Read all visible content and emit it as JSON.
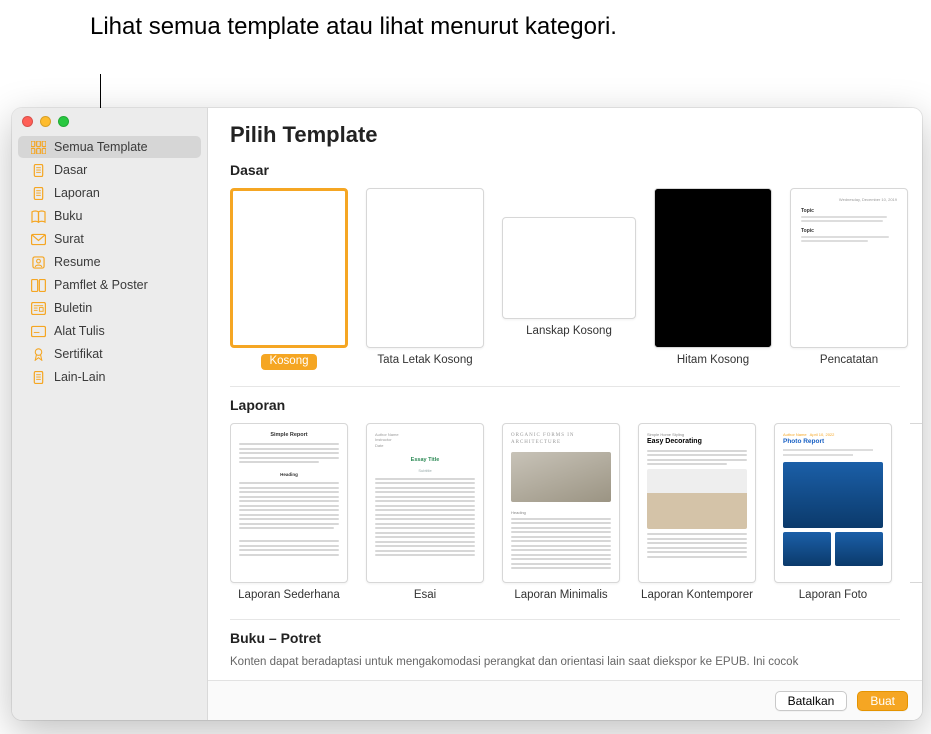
{
  "annotation": "Lihat semua template atau lihat menurut kategori.",
  "window_title": "Pilih Template",
  "sidebar": {
    "items": [
      {
        "label": "Semua Template",
        "icon": "grid",
        "selected": true
      },
      {
        "label": "Dasar",
        "icon": "page",
        "selected": false
      },
      {
        "label": "Laporan",
        "icon": "page",
        "selected": false
      },
      {
        "label": "Buku",
        "icon": "book",
        "selected": false
      },
      {
        "label": "Surat",
        "icon": "mail",
        "selected": false
      },
      {
        "label": "Resume",
        "icon": "person",
        "selected": false
      },
      {
        "label": "Pamflet & Poster",
        "icon": "spread",
        "selected": false
      },
      {
        "label": "Buletin",
        "icon": "news",
        "selected": false
      },
      {
        "label": "Alat Tulis",
        "icon": "card",
        "selected": false
      },
      {
        "label": "Sertifikat",
        "icon": "ribbon",
        "selected": false
      },
      {
        "label": "Lain-Lain",
        "icon": "page",
        "selected": false
      }
    ]
  },
  "sections": {
    "dasar": {
      "title": "Dasar",
      "templates": [
        {
          "label": "Kosong",
          "variant": "blank",
          "selected": true
        },
        {
          "label": "Tata Letak Kosong",
          "variant": "blank",
          "selected": false
        },
        {
          "label": "Lanskap Kosong",
          "variant": "blank-wide",
          "selected": false
        },
        {
          "label": "Hitam Kosong",
          "variant": "black",
          "selected": false
        },
        {
          "label": "Pencatatan",
          "variant": "notes",
          "selected": false
        }
      ]
    },
    "laporan": {
      "title": "Laporan",
      "templates": [
        {
          "label": "Laporan Sederhana",
          "variant": "simple-report",
          "thumb_title": "Simple Report"
        },
        {
          "label": "Esai",
          "variant": "essay",
          "thumb_title": "Essay Title",
          "thumb_sub": "Subtitle"
        },
        {
          "label": "Laporan Minimalis",
          "variant": "minimal",
          "thumb_title": "ORGANIC FORMS IN ARCHITECTURE"
        },
        {
          "label": "Laporan Kontemporer",
          "variant": "contemporary",
          "thumb_title": "Easy Decorating",
          "thumb_pre": "Simple Home Styling"
        },
        {
          "label": "Laporan Foto",
          "variant": "photo",
          "thumb_title": "Photo Report"
        }
      ]
    },
    "buku": {
      "title": "Buku – Potret",
      "subtitle": "Konten dapat beradaptasi untuk mengakomodasi perangkat dan orientasi lain saat diekspor ke EPUB. Ini cocok"
    }
  },
  "footer": {
    "cancel": "Batalkan",
    "create": "Buat"
  }
}
